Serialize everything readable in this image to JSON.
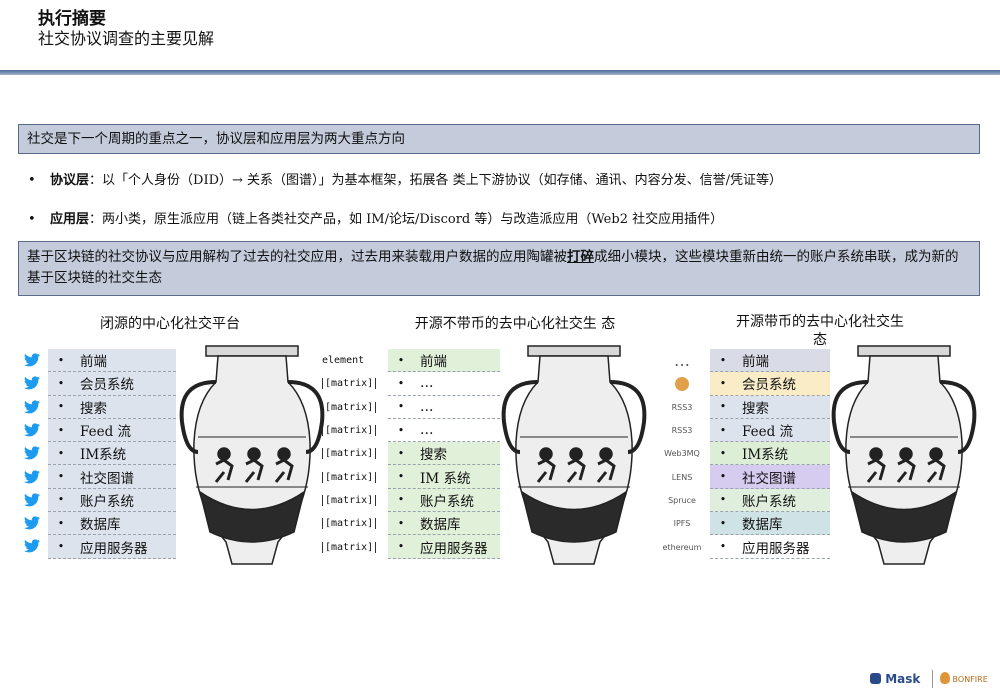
{
  "header": {
    "title": "执行摘要",
    "subtitle": "社交协议调查的主要见解"
  },
  "box1": "社交是下一个周期的重点之一，协议层和应用层为两大重点方向",
  "bullets": [
    {
      "label": "协议层",
      "text": "：以「个人身份（DID）→ 关系（图谱）」为基本框架，拓展各 类上下游协议（如存储、通讯、内容分发、信誉/凭证等）"
    },
    {
      "label": "应用层",
      "text": "：两小类，原生派应用（链上各类社交产品，如 IM/论坛/Discord 等）与改造派应用（Web2 社交应用插件）"
    }
  ],
  "box2": {
    "before": "基于区块链的社交协议与应用解构了过去的社交应用，过去用来装载用户数据的应用陶罐被",
    "emph": "打碎",
    "after": "成细小模块，这些模块重新由统一的账户系统串联，成为新的基于区块链的社交生态"
  },
  "columns": [
    {
      "title": "闭源的中心化社交平台",
      "items": [
        "前端",
        "会员系统",
        "搜索",
        "Feed 流",
        "IM系统",
        "社交图谱",
        "账户系统",
        "数据库",
        "应用服务器"
      ],
      "brands": [
        "element",
        "[matrix]",
        "[matrix]",
        "[matrix]",
        "[matrix]",
        "[matrix]",
        "[matrix]",
        "[matrix]",
        "[matrix]"
      ]
    },
    {
      "title": "开源不带币的去中心化社交生 态",
      "items": [
        "前端",
        "…",
        "…",
        "…",
        "搜索",
        "IM 系统",
        "账户系统",
        "数据库",
        "应用服务器"
      ]
    },
    {
      "title_line1": "开源带币的去中心化社交生",
      "title_line2": "态",
      "items": [
        "前端",
        "会员系统",
        "搜索",
        "Feed 流",
        "IM系统",
        "社交图谱",
        "账户系统",
        "数据库",
        "应用服务器"
      ],
      "colors": [
        "#d9dbe6",
        "#fbecc8",
        "#dde3ed",
        "#dde3ed",
        "#dcefd6",
        "#d6ccf0",
        "#e0eede",
        "#cfe3e6",
        "#ffffff"
      ],
      "logos": [
        "…",
        "",
        "RSS3",
        "RSS3",
        "Web3MQ",
        "LENS",
        "Spruce",
        "IPFS",
        "ethereum"
      ]
    }
  ],
  "footer": {
    "brand1": "Mask",
    "brand2": "BONFIRE"
  }
}
